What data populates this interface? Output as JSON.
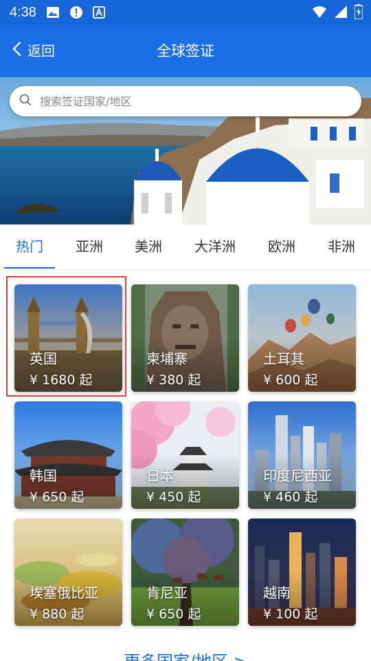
{
  "status": {
    "time": "4:38"
  },
  "appbar": {
    "back_label": "返回",
    "title": "全球签证"
  },
  "search": {
    "placeholder": "搜索签证国家/地区"
  },
  "tabs": [
    {
      "label": "热门"
    },
    {
      "label": "亚洲"
    },
    {
      "label": "美洲"
    },
    {
      "label": "大洋洲"
    },
    {
      "label": "欧洲"
    },
    {
      "label": "非洲"
    }
  ],
  "countries": [
    {
      "name": "英国",
      "price": "¥ 1680 起"
    },
    {
      "name": "柬埔寨",
      "price": "¥ 380 起"
    },
    {
      "name": "土耳其",
      "price": "¥ 600 起"
    },
    {
      "name": "韩国",
      "price": "¥ 650 起"
    },
    {
      "name": "日本",
      "price": "¥ 450 起"
    },
    {
      "name": "印度尼西亚",
      "price": "¥ 460 起"
    },
    {
      "name": "埃塞俄比亚",
      "price": "¥ 880 起"
    },
    {
      "name": "肯尼亚",
      "price": "¥ 650 起"
    },
    {
      "name": "越南",
      "price": "¥ 100 起"
    }
  ],
  "footer": {
    "more_label": "更多国家/地区 >"
  },
  "colors": {
    "primary": "#1a6ee6",
    "status_bar": "#1666d8",
    "highlight": "#d9413c"
  }
}
